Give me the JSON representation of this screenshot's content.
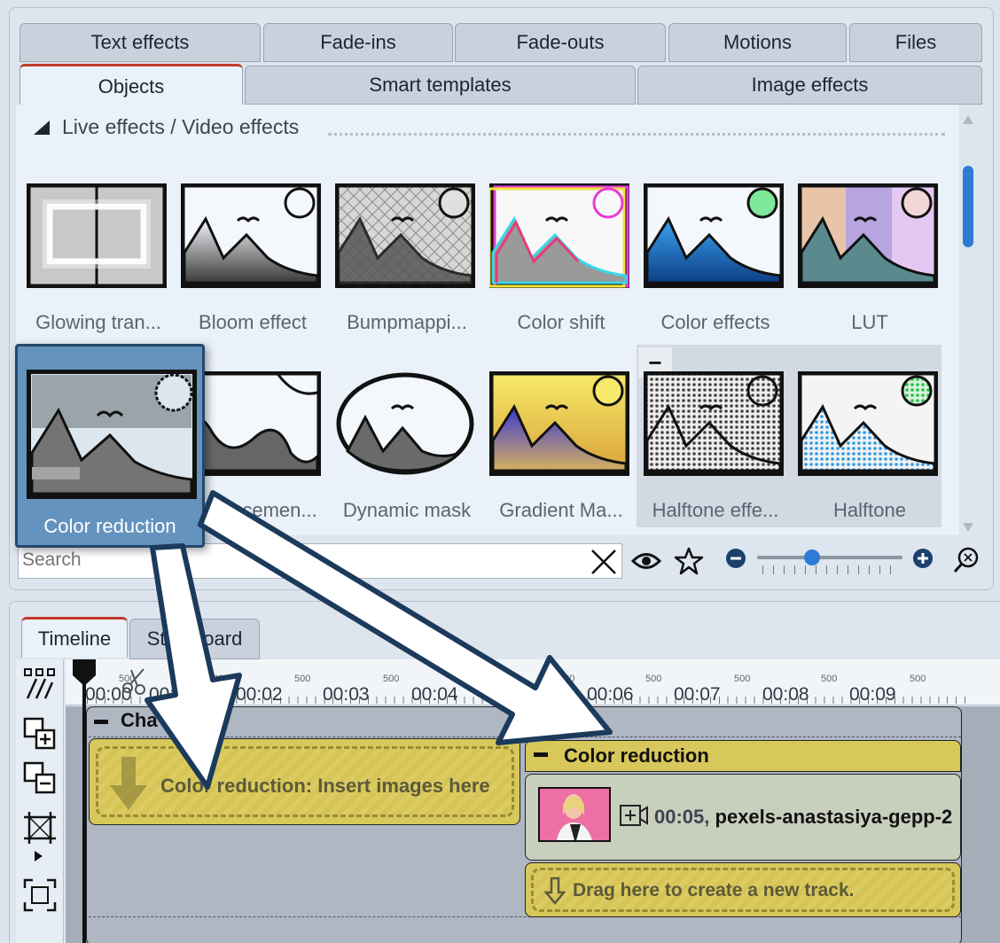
{
  "tabs_row1": [
    "Text effects",
    "Fade-ins",
    "Fade-outs",
    "Motions",
    "Files"
  ],
  "tabs_row2": [
    "Objects",
    "Smart templates",
    "Image effects"
  ],
  "active_tab": "Objects",
  "section": {
    "title": "Live effects / Video effects"
  },
  "effects_row1": [
    "Glowing tran...",
    "Bloom effect",
    "Bumpmappi...",
    "Color shift",
    "Color effects",
    "LUT"
  ],
  "effects_row2": [
    "Color reduction",
    "Displacemen...",
    "Dynamic mask",
    "Gradient Ma...",
    "Halftone effe...",
    "Halftone"
  ],
  "hovered_group_symbol": "−",
  "search": {
    "placeholder": "Search",
    "value": ""
  },
  "bottom_tabs": [
    "Timeline",
    "Storyboard"
  ],
  "ruler": {
    "labels": [
      "00:00",
      "00:01",
      "00:02",
      "00:03",
      "00:04",
      "00:05",
      "00:06",
      "00:07",
      "00:08",
      "00:09"
    ],
    "half_label": "500"
  },
  "timeline": {
    "chapter_title": "Cha",
    "insert_text": "Color reduction: Insert images here",
    "effect_title": "Color reduction",
    "clip_time": "00:05,",
    "clip_name": "pexels-anastasiya-gepp-2",
    "drag_text": "Drag here to create a new track."
  },
  "colors": {
    "accent": "#2e7bd6",
    "active_tab_line": "#c0392b",
    "selection": "#6493bd",
    "track_yellow": "#d8c75a"
  }
}
